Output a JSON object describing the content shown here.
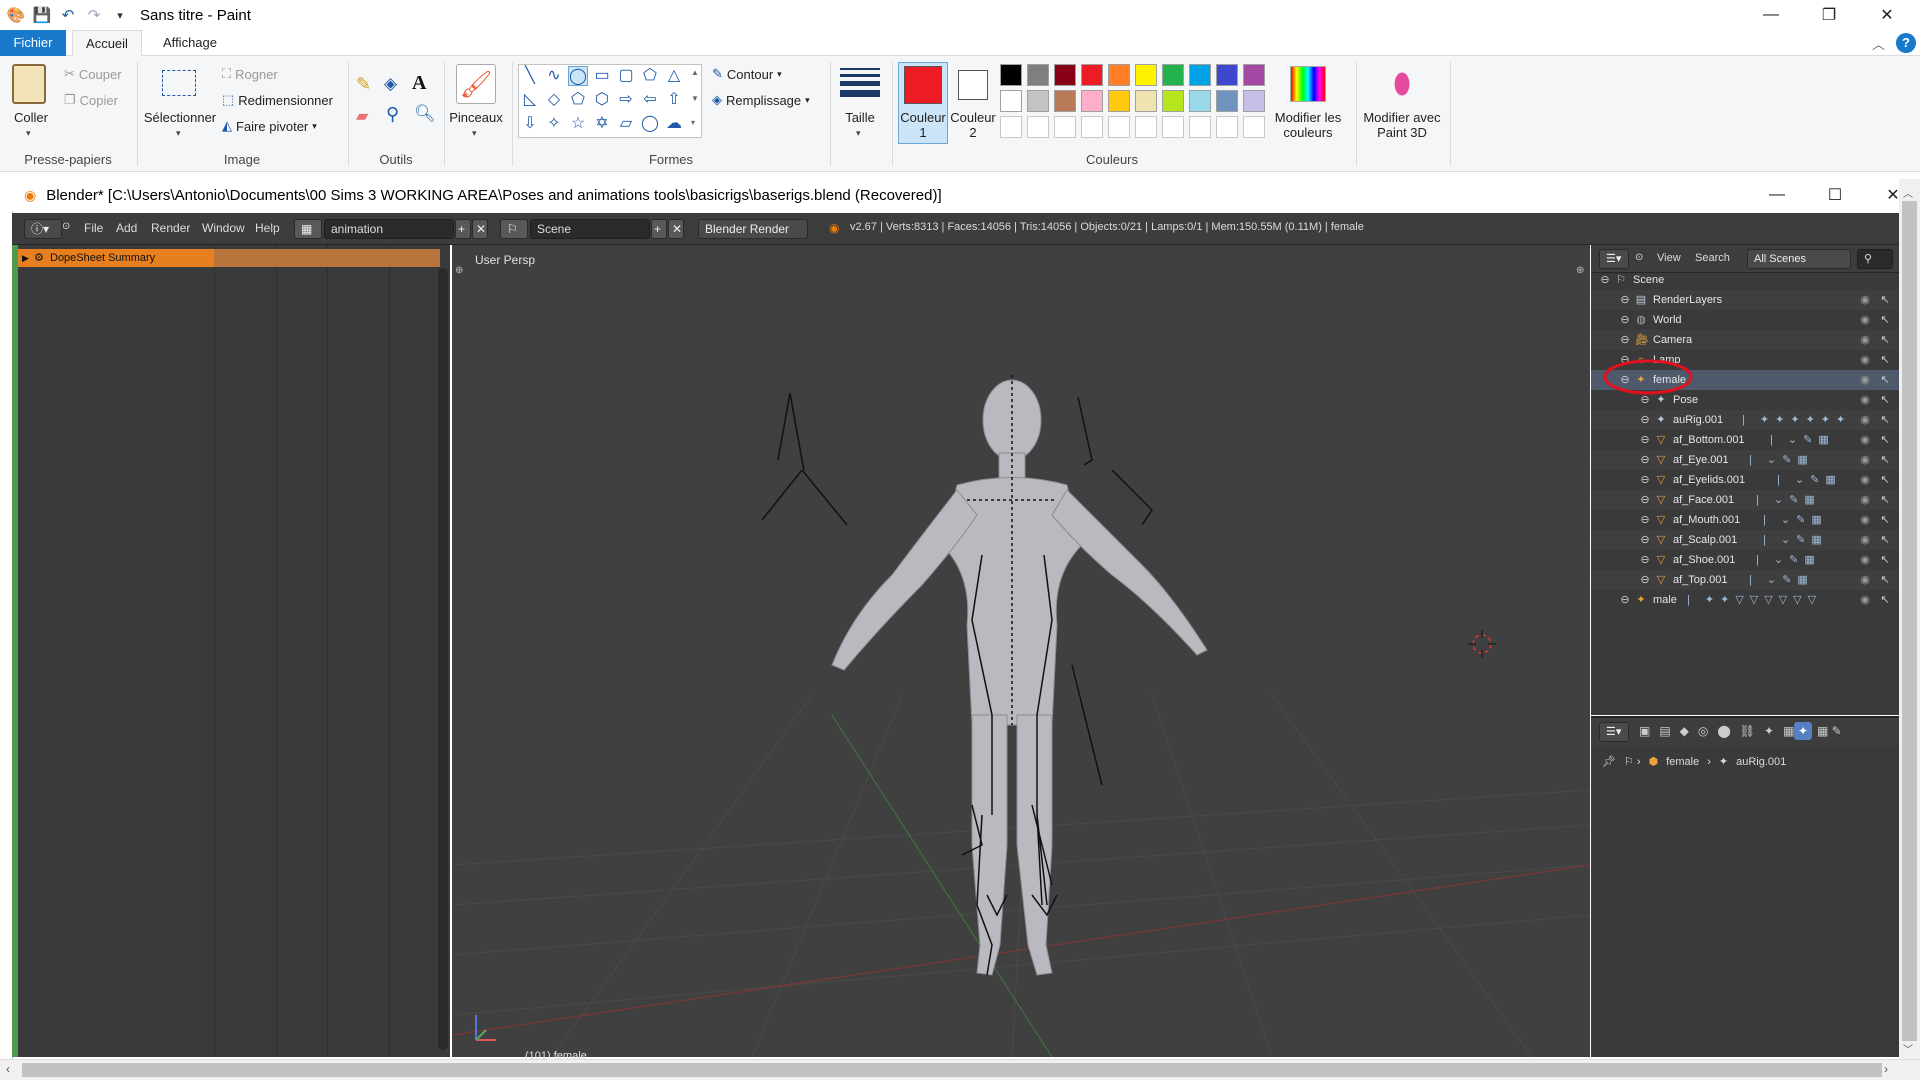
{
  "paint": {
    "title": "Sans titre - Paint",
    "tabs": {
      "file": "Fichier",
      "home": "Accueil",
      "view": "Affichage"
    },
    "clipboard": {
      "paste": "Coller",
      "cut": "Couper",
      "copy": "Copier",
      "label": "Presse-papiers"
    },
    "image": {
      "select": "Sélectionner",
      "crop": "Rogner",
      "resize": "Redimensionner",
      "rotate": "Faire pivoter",
      "label": "Image"
    },
    "tools": {
      "label": "Outils"
    },
    "brushes": {
      "label": "Pinceaux"
    },
    "shapes": {
      "outline": "Contour",
      "fill": "Remplissage",
      "label": "Formes"
    },
    "size": {
      "label": "Taille"
    },
    "colors": {
      "color1": "Couleur 1",
      "color2": "Couleur 2",
      "edit": "Modifier les couleurs",
      "paint3d": "Modifier avec Paint 3D",
      "label": "Couleurs",
      "active_color1": "#ed1c24",
      "active_color2": "#ffffff",
      "palette_row1": [
        "#000000",
        "#7f7f7f",
        "#880015",
        "#ed1c24",
        "#ff7f27",
        "#fff200",
        "#22b14c",
        "#00a2e8",
        "#3f48cc",
        "#a349a4"
      ],
      "palette_row2": [
        "#ffffff",
        "#c3c3c3",
        "#b97a57",
        "#ffaec9",
        "#ffc90e",
        "#efe4b0",
        "#b5e61d",
        "#99d9ea",
        "#7092be",
        "#c8bfe7"
      ]
    }
  },
  "blender": {
    "title": "Blender* [C:\\Users\\Antonio\\Documents\\00 Sims 3 WORKING AREA\\Poses and animations tools\\basicrigs\\baserigs.blend (Recovered)]",
    "menu": [
      "File",
      "Add",
      "Render",
      "Window",
      "Help"
    ],
    "layout": "animation",
    "scene": "Scene",
    "engine": "Blender Render",
    "stats": "v2.67 | Verts:8313 | Faces:14056 | Tris:14056 | Objects:0/21 | Lamps:0/1 | Mem:150.55M (0.11M) | female",
    "dopesheet_summary": "DopeSheet Summary",
    "viewport_label": "User Persp",
    "viewport_bottom": "(101) female",
    "outliner": {
      "view": "View",
      "search": "Search",
      "filter": "All Scenes",
      "rows": [
        {
          "name": "Scene",
          "indent": 0
        },
        {
          "name": "RenderLayers",
          "indent": 1
        },
        {
          "name": "World",
          "indent": 1
        },
        {
          "name": "Camera",
          "indent": 1
        },
        {
          "name": "Lamp",
          "indent": 1
        },
        {
          "name": "female",
          "indent": 1
        },
        {
          "name": "Pose",
          "indent": 2
        },
        {
          "name": "auRig.001",
          "indent": 2
        },
        {
          "name": "af_Bottom.001",
          "indent": 2
        },
        {
          "name": "af_Eye.001",
          "indent": 2
        },
        {
          "name": "af_Eyelids.001",
          "indent": 2
        },
        {
          "name": "af_Face.001",
          "indent": 2
        },
        {
          "name": "af_Mouth.001",
          "indent": 2
        },
        {
          "name": "af_Scalp.001",
          "indent": 2
        },
        {
          "name": "af_Shoe.001",
          "indent": 2
        },
        {
          "name": "af_Top.001",
          "indent": 2
        },
        {
          "name": "male",
          "indent": 1
        }
      ]
    },
    "props_breadcrumb": {
      "object": "female",
      "data": "auRig.001"
    }
  }
}
